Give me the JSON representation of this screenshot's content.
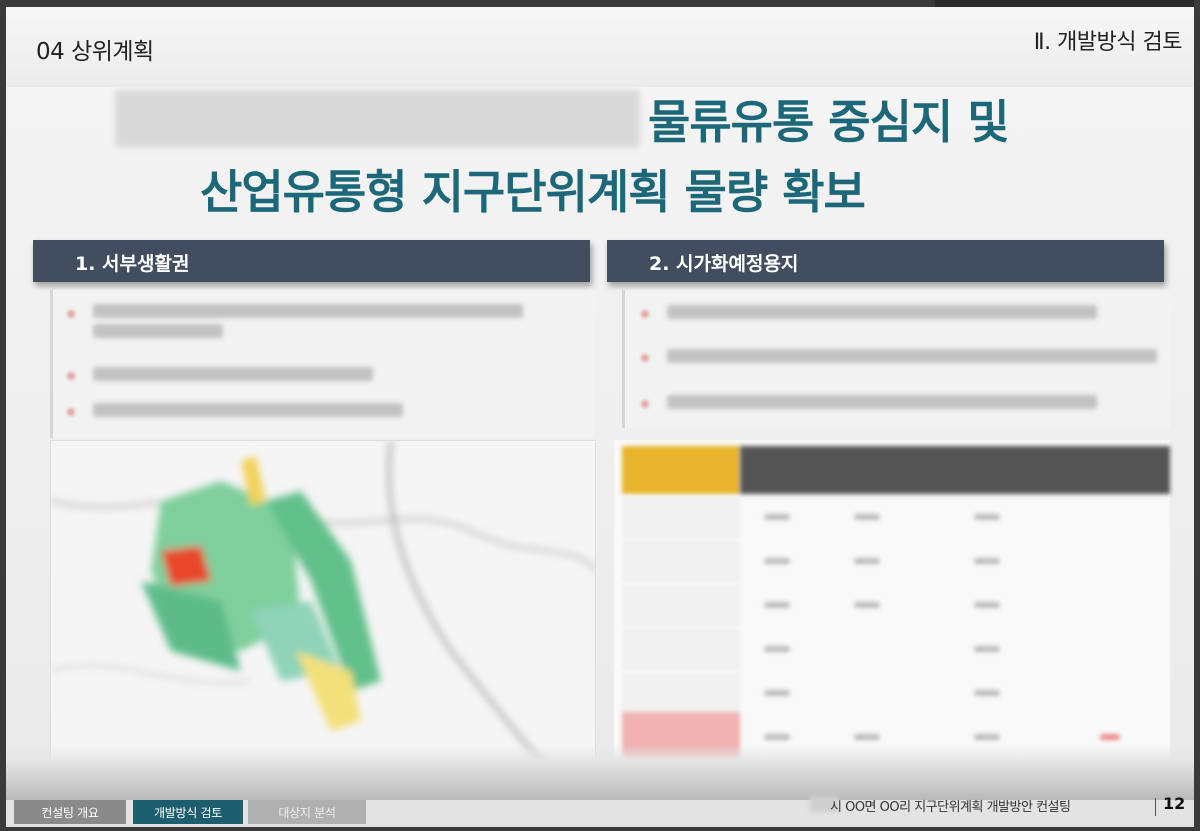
{
  "header": {
    "section_title": "04 상위계획",
    "chapter_title": "Ⅱ. 개발방식 검토"
  },
  "headline": {
    "line1": "물류유통 중심지 및",
    "line2": "산업유통형 지구단위계획 물량 확보"
  },
  "panels": [
    {
      "title": "1. 서부생활권"
    },
    {
      "title": "2. 시가화예정용지"
    }
  ],
  "footer": {
    "tabs": [
      {
        "label": "컨설팅 개요",
        "active": false
      },
      {
        "label": "개발방식 검토",
        "active": true
      },
      {
        "label": "대상지 분석",
        "active": false
      }
    ],
    "title": "시 OO면 OO리 지구단위계획 개발방안 컨설팅",
    "page_number": "12"
  },
  "colors": {
    "accent": "#1c6878",
    "panel_bar": "#424e5f",
    "active_tab": "#1c5e6e",
    "table_header": "#e8b42c"
  }
}
